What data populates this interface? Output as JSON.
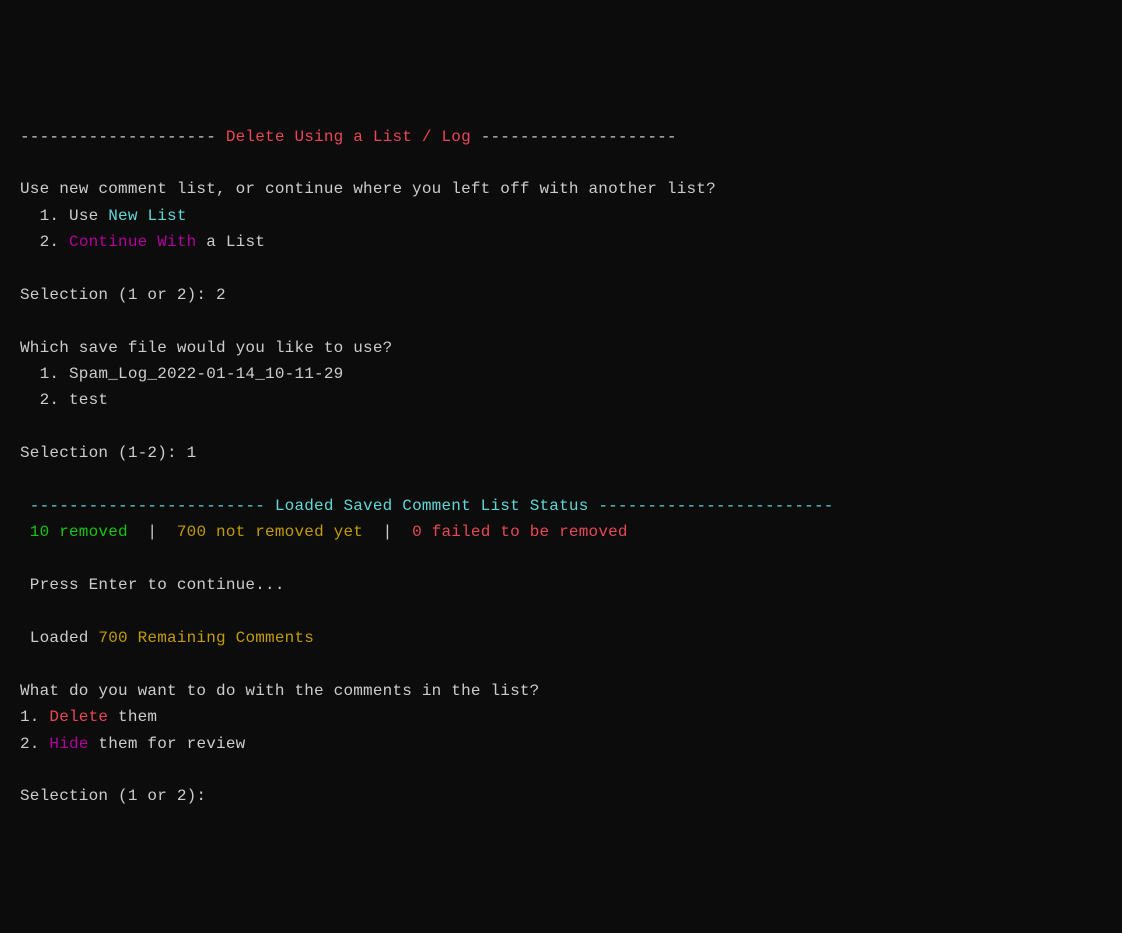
{
  "header": {
    "dashes_left": "--------------------",
    "title": " Delete Using a List / Log ",
    "dashes_right": "--------------------"
  },
  "prompt1": {
    "question": "Use new comment list, or continue where you left off with another list?",
    "option1_number": "  1. ",
    "option1_pre": "Use ",
    "option1_color": "New List",
    "option2_number": "  2. ",
    "option2_color": "Continue With",
    "option2_post": " a List",
    "selection_label": "Selection (1 or 2): ",
    "selection_value": "2"
  },
  "prompt2": {
    "question": "Which save file would you like to use?",
    "option1": "  1. Spam_Log_2022-01-14_10-11-29",
    "option2": "  2. test",
    "selection_label": "Selection (1-2): ",
    "selection_value": "1"
  },
  "status": {
    "dashes_left": " ------------------------",
    "title": " Loaded Saved Comment List Status ",
    "dashes_right": "------------------------",
    "removed": " 10 removed",
    "sep1": "  |  ",
    "not_removed": "700 not removed yet",
    "sep2": "  |  ",
    "failed_count": "0",
    "failed_text": " failed to be removed"
  },
  "continue_prompt": " Press Enter to continue...",
  "loaded": {
    "prefix": " Loaded ",
    "count": "700 Remaining Comments"
  },
  "prompt3": {
    "question": "What do you want to do with the comments in the list?",
    "option1_number": "1. ",
    "option1_color": "Delete",
    "option1_post": " them",
    "option2_number": "2. ",
    "option2_color": "Hide",
    "option2_post": " them for review",
    "selection_label": "Selection (1 or 2): "
  }
}
